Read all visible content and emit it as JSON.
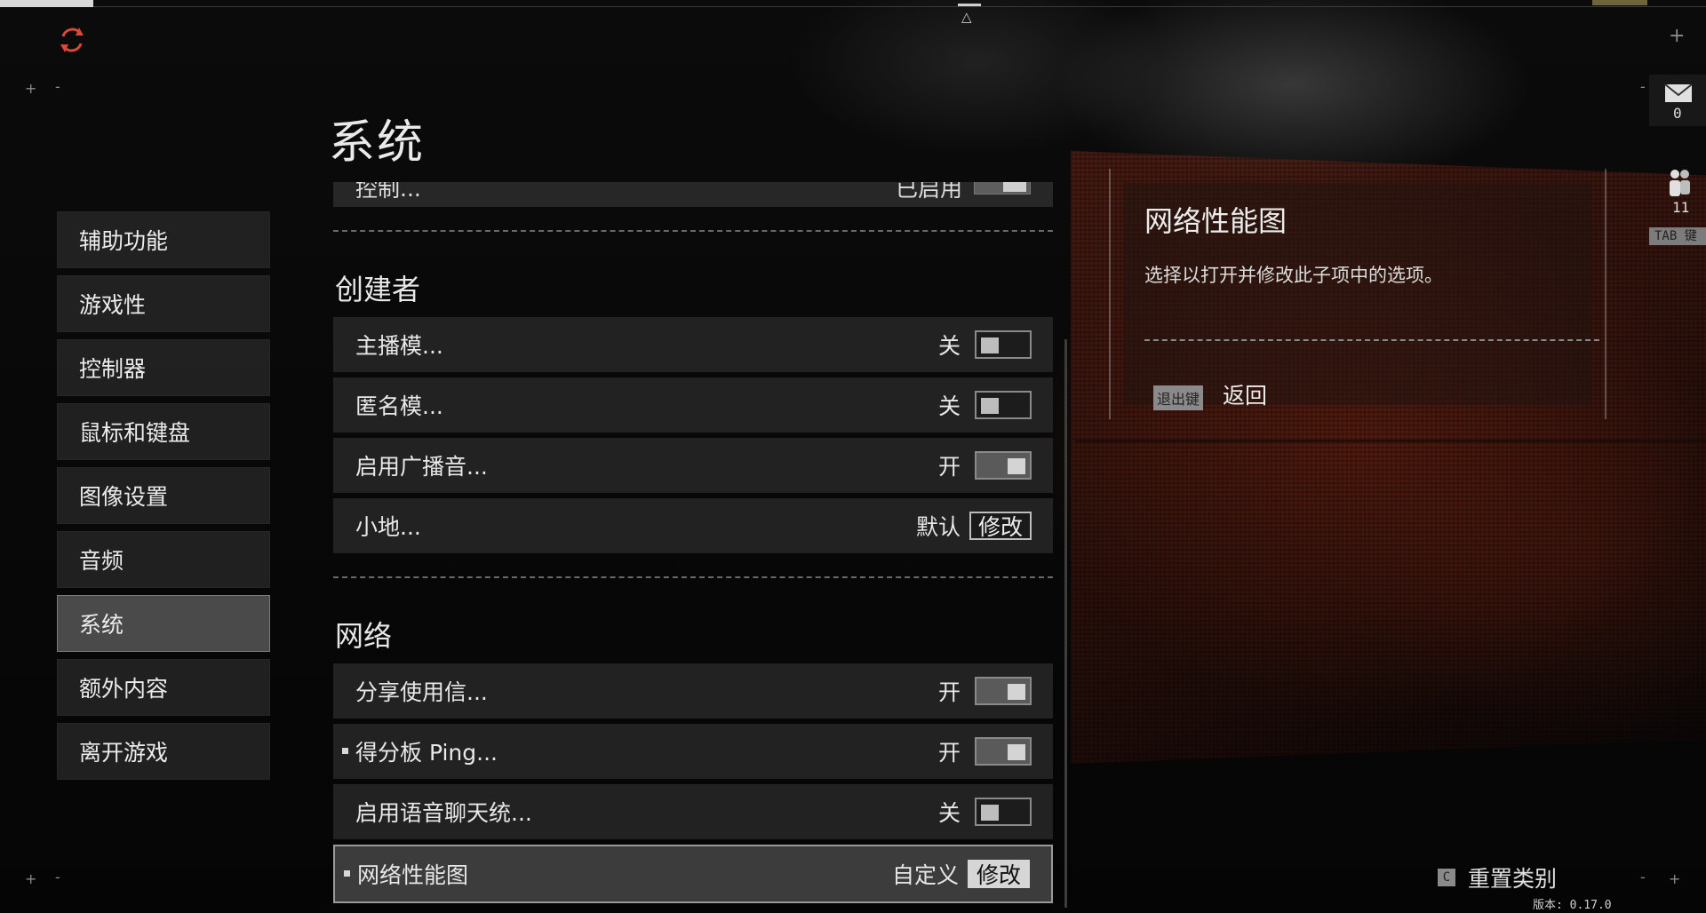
{
  "page_title": "系统",
  "sidebar": {
    "items": [
      {
        "label": "辅助功能"
      },
      {
        "label": "游戏性"
      },
      {
        "label": "控制器"
      },
      {
        "label": "鼠标和键盘"
      },
      {
        "label": "图像设置"
      },
      {
        "label": "音频"
      },
      {
        "label": "系统",
        "active": true
      },
      {
        "label": "额外内容"
      },
      {
        "label": "离开游戏"
      }
    ]
  },
  "list": {
    "cut_row": {
      "label": "控制...",
      "value": "已启用",
      "toggle": "on"
    },
    "sections": [
      {
        "title": "创建者",
        "rows": [
          {
            "label": "主播模...",
            "value": "关",
            "control": "toggle-off"
          },
          {
            "label": "匿名模...",
            "value": "关",
            "control": "toggle-off"
          },
          {
            "label": "启用广播音...",
            "value": "开",
            "control": "toggle-on"
          },
          {
            "label": "小地...",
            "value": "默认",
            "control": "button",
            "button_label": "修改"
          }
        ]
      },
      {
        "title": "网络",
        "rows": [
          {
            "label": "分享使用信...",
            "value": "开",
            "control": "toggle-on"
          },
          {
            "label": "得分板 Ping...",
            "value": "开",
            "control": "toggle-on",
            "bullet": true
          },
          {
            "label": "启用语音聊天统...",
            "value": "关",
            "control": "toggle-off"
          },
          {
            "label": "网络性能图",
            "value": "自定义",
            "control": "button",
            "button_label": "修改",
            "bullet": true,
            "selected": true
          }
        ]
      }
    ]
  },
  "info_panel": {
    "title": "网络性能图",
    "description": "选择以打开并修改此子项中的选项。",
    "back_key": "退出键",
    "back_label": "返回"
  },
  "right_rail": {
    "mail_count": "0",
    "party_count": "11",
    "tab_key_label": "TAB 键"
  },
  "footer": {
    "reset_key": "C",
    "reset_label": "重置类别",
    "version": "版本: 0.17.0"
  },
  "colors": {
    "accent_refresh": "#d94a36",
    "panel_bg": "#2a2a2a",
    "selected_outline": "#9a9a9a",
    "wall_red": "#7a2816"
  },
  "icons": [
    "refresh-icon",
    "mail-icon",
    "party-icon"
  ]
}
